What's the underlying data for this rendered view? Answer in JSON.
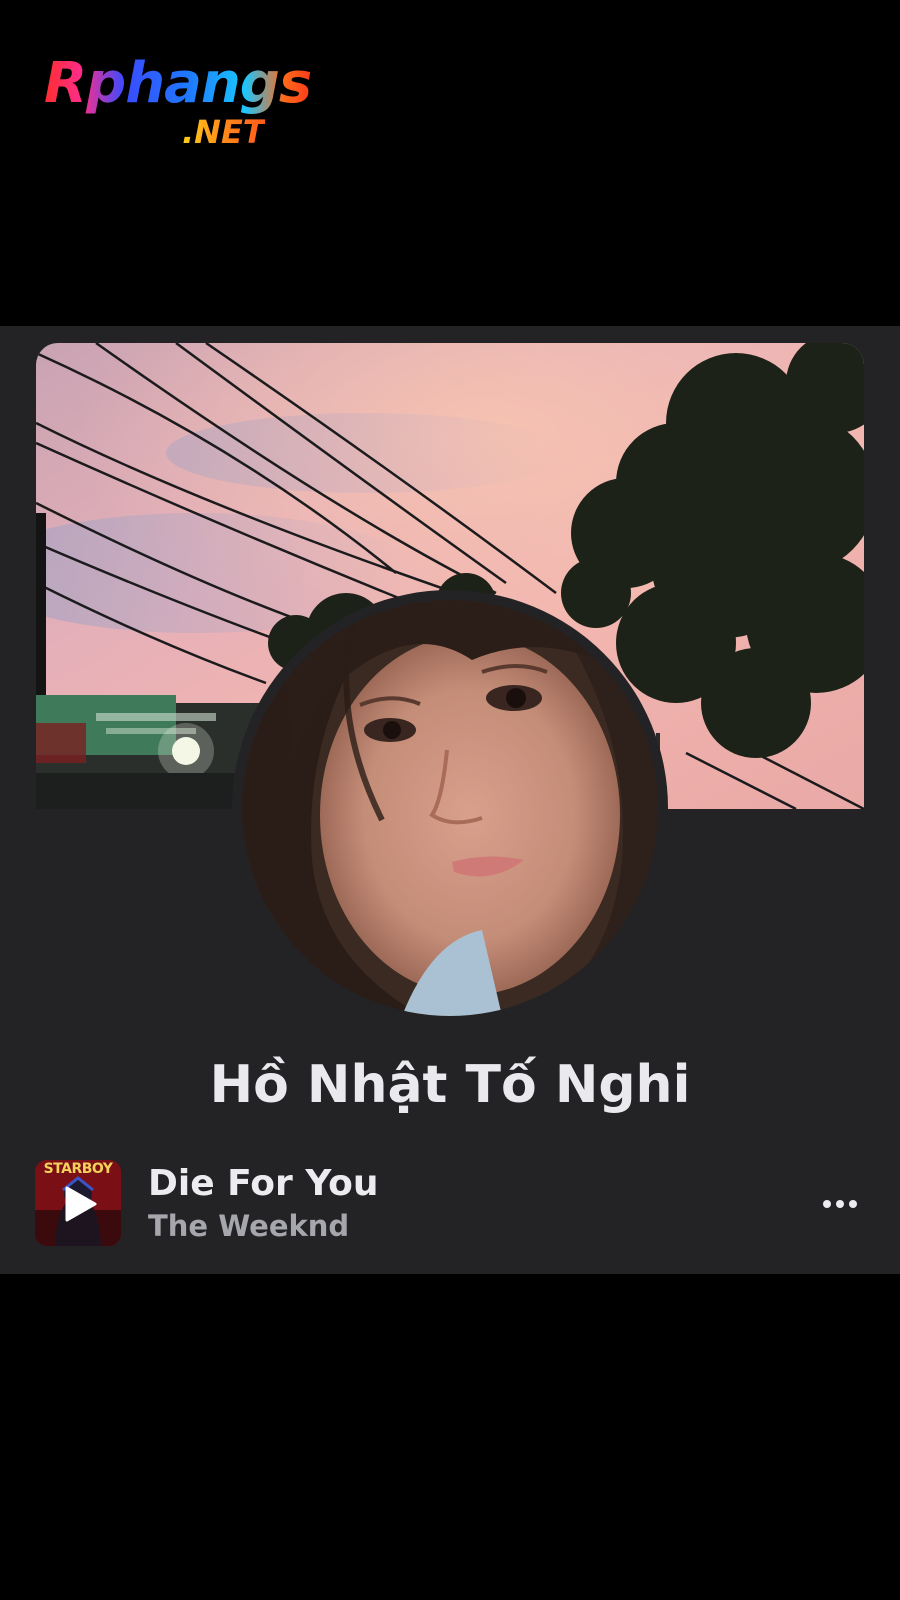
{
  "watermark": {
    "brand": "Rphangs",
    "suffix": ".NET"
  },
  "profile": {
    "name": "Hồ Nhật Tố Nghi"
  },
  "music": {
    "album_text": "STARBOY",
    "song_title": "Die For You",
    "artist": "The Weeknd",
    "play_icon": "play-icon",
    "more_icon": "more-icon"
  },
  "colors": {
    "page_background": "#000000",
    "card_background": "#232325",
    "name_text": "#e9e9ee",
    "artist_text": "#a6a6ad"
  }
}
